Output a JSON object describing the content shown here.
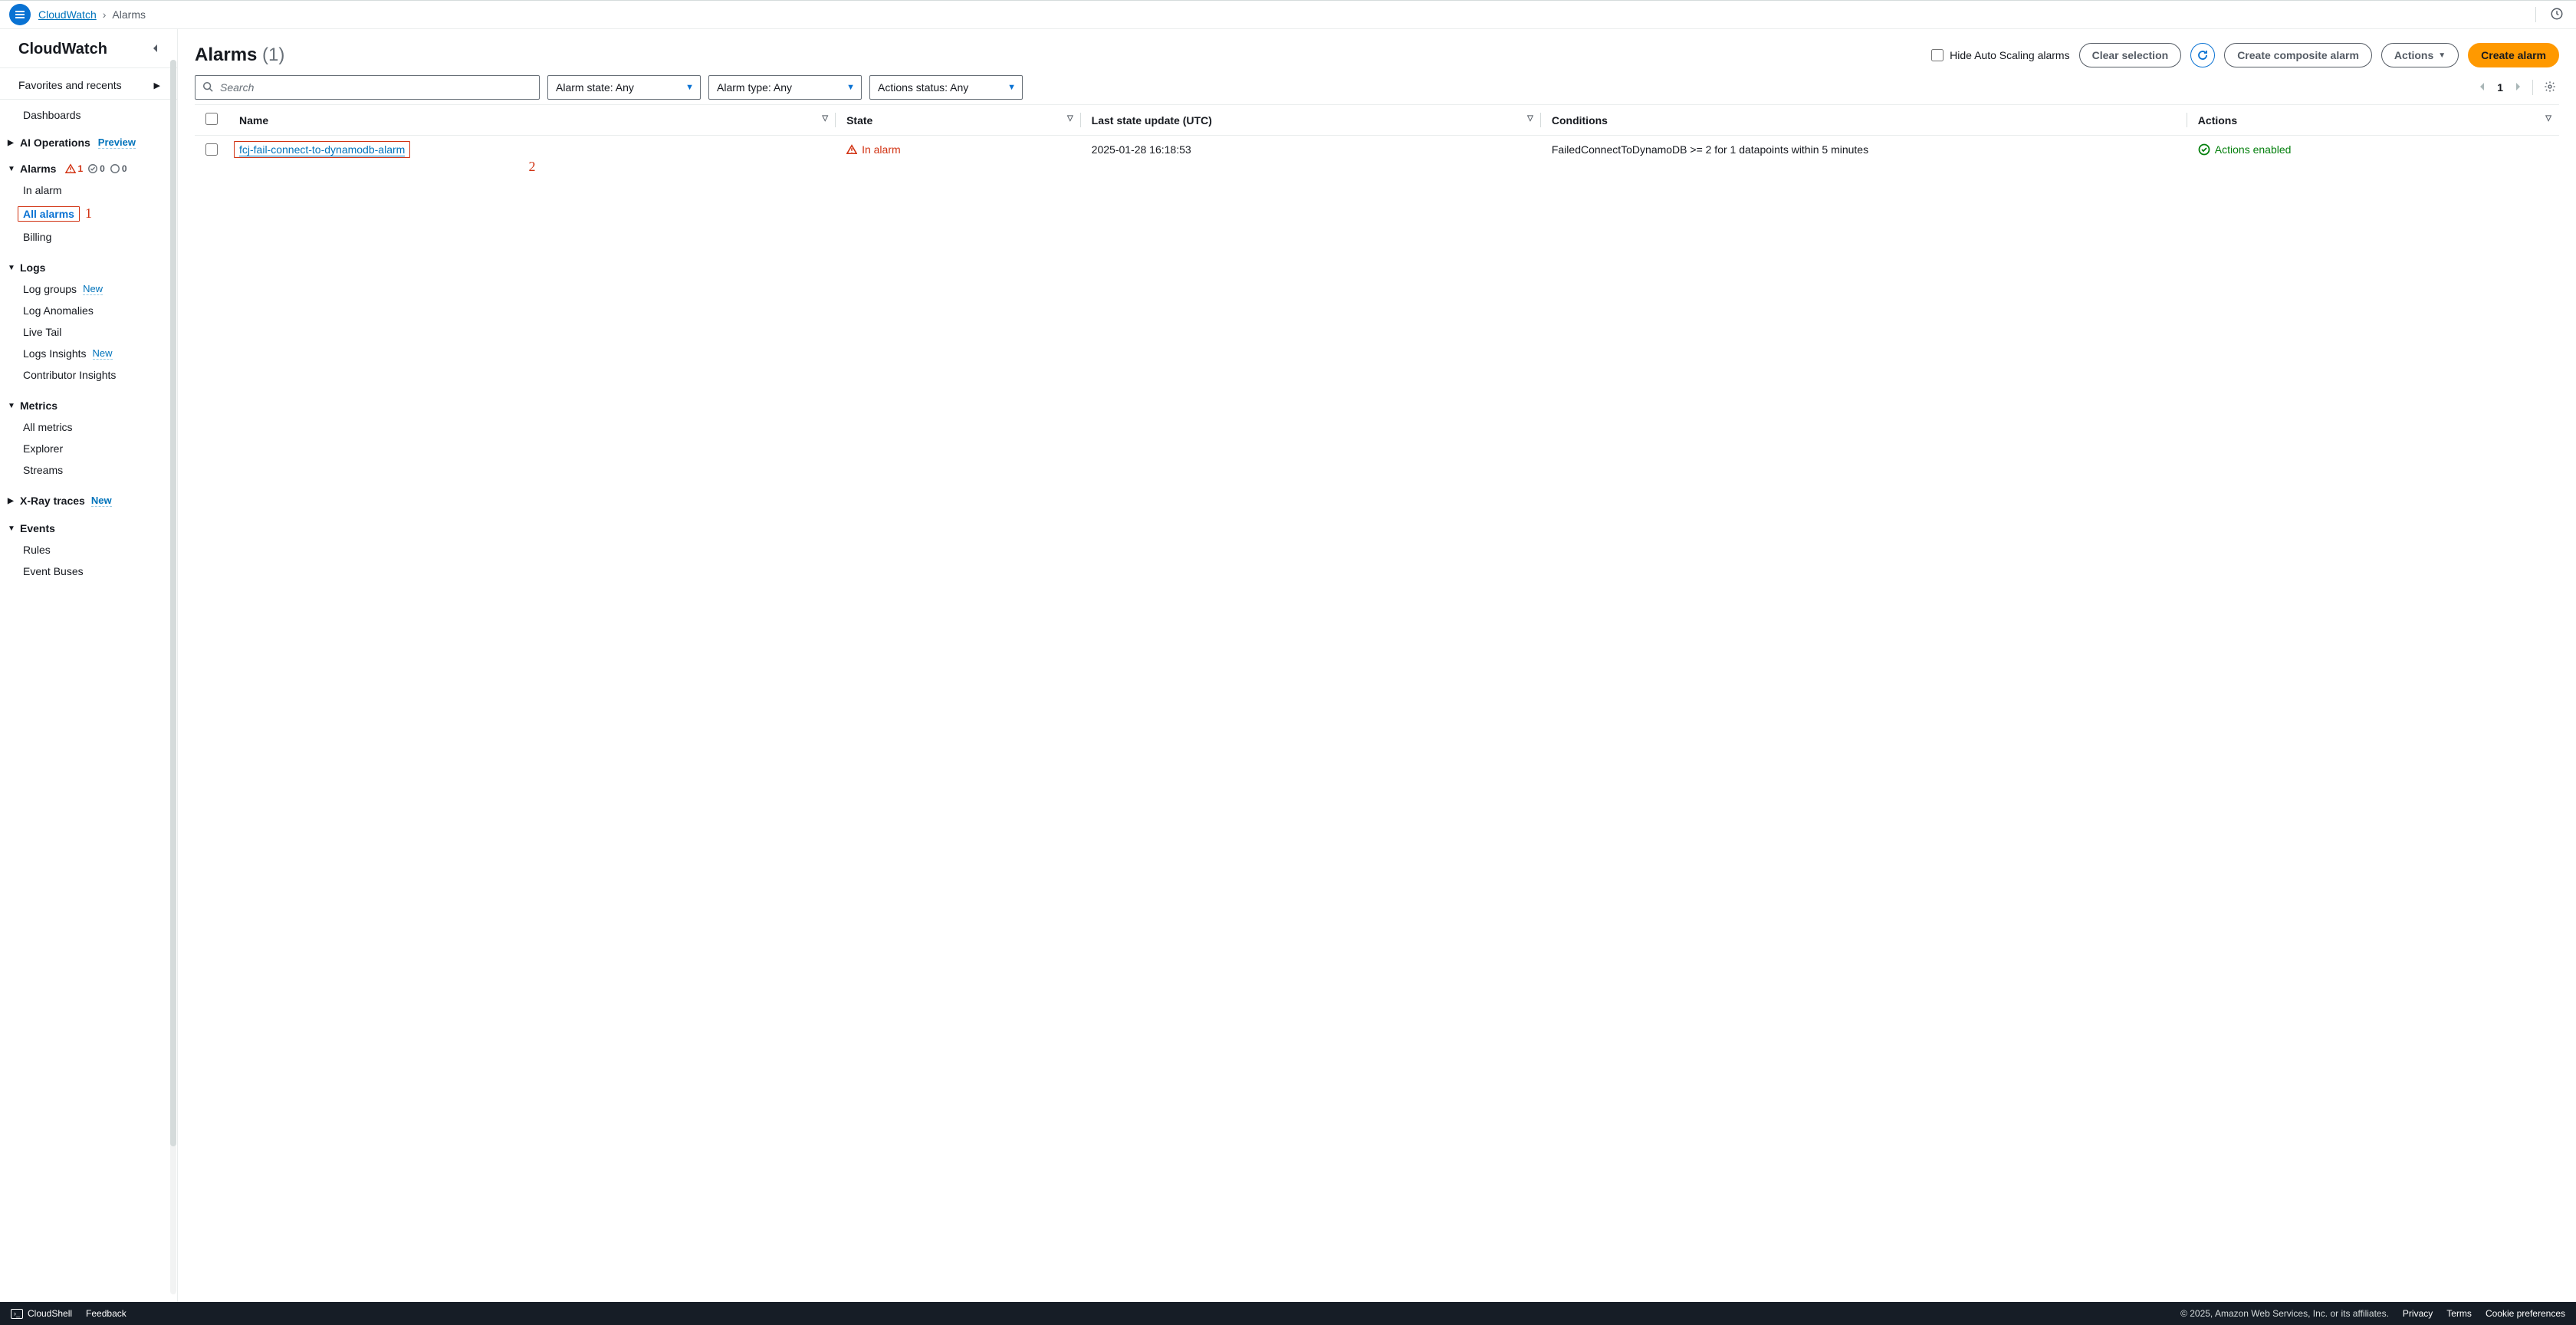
{
  "breadcrumb": {
    "service": "CloudWatch",
    "current": "Alarms"
  },
  "sidebar": {
    "title": "CloudWatch",
    "favorites_label": "Favorites and recents",
    "dashboards_label": "Dashboards",
    "ai_ops": {
      "label": "AI Operations",
      "badge": "Preview"
    },
    "alarms": {
      "label": "Alarms",
      "in_alarm_count": "1",
      "ok_count": "0",
      "insufficient_count": "0",
      "items": {
        "in_alarm": "In alarm",
        "all_alarms": "All alarms",
        "billing": "Billing"
      }
    },
    "logs": {
      "label": "Logs",
      "log_groups": "Log groups",
      "log_anomalies": "Log Anomalies",
      "live_tail": "Live Tail",
      "logs_insights": "Logs Insights",
      "contributor_insights": "Contributor Insights"
    },
    "metrics": {
      "label": "Metrics",
      "all_metrics": "All metrics",
      "explorer": "Explorer",
      "streams": "Streams"
    },
    "xray": {
      "label": "X-Ray traces",
      "badge": "New"
    },
    "events": {
      "label": "Events",
      "rules": "Rules",
      "event_buses": "Event Buses"
    },
    "new_badge": "New"
  },
  "annotations": {
    "one": "1",
    "two": "2"
  },
  "main": {
    "title": "Alarms",
    "count": "(1)",
    "hide_autoscaling_label": "Hide Auto Scaling alarms",
    "buttons": {
      "clear_selection": "Clear selection",
      "create_composite": "Create composite alarm",
      "actions": "Actions",
      "create_alarm": "Create alarm"
    },
    "search_placeholder": "Search",
    "filters": {
      "alarm_state": "Alarm state: Any",
      "alarm_type": "Alarm type: Any",
      "actions_status": "Actions status: Any"
    },
    "pager": {
      "current": "1"
    },
    "columns": {
      "name": "Name",
      "state": "State",
      "last_update": "Last state update (UTC)",
      "conditions": "Conditions",
      "actions": "Actions"
    },
    "rows": [
      {
        "name": "fcj-fail-connect-to-dynamodb-alarm",
        "state": "In alarm",
        "last_update": "2025-01-28 16:18:53",
        "conditions": "FailedConnectToDynamoDB >= 2 for 1 datapoints within 5 minutes",
        "actions": "Actions enabled"
      }
    ]
  },
  "footer": {
    "cloudshell": "CloudShell",
    "feedback": "Feedback",
    "copyright": "© 2025, Amazon Web Services, Inc. or its affiliates.",
    "privacy": "Privacy",
    "terms": "Terms",
    "cookie": "Cookie preferences"
  }
}
